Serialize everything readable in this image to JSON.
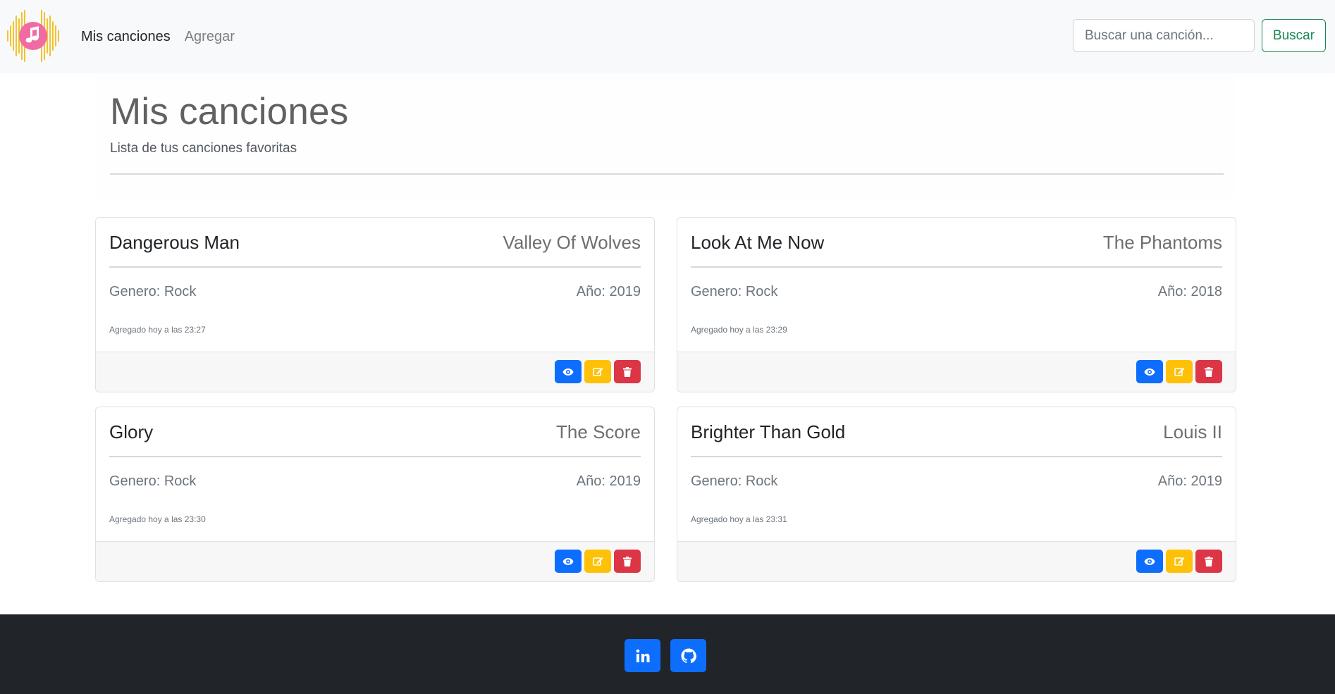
{
  "navbar": {
    "brand_icon": "music-note-logo",
    "links": [
      {
        "label": "Mis canciones",
        "active": true
      },
      {
        "label": "Agregar",
        "active": false
      }
    ],
    "search": {
      "placeholder": "Buscar una canción...",
      "value": "",
      "button_label": "Buscar"
    }
  },
  "header": {
    "title": "Mis canciones",
    "subtitle": "Lista de tus canciones favoritas"
  },
  "songs": [
    {
      "title": "Dangerous Man",
      "artist": "Valley Of Wolves",
      "genre": "Genero: Rock",
      "year": "Año: 2019",
      "added": "Agregado hoy a las 23:27"
    },
    {
      "title": "Look At Me Now",
      "artist": "The Phantoms",
      "genre": "Genero: Rock",
      "year": "Año: 2018",
      "added": "Agregado hoy a las 23:29"
    },
    {
      "title": "Glory",
      "artist": "The Score",
      "genre": "Genero: Rock",
      "year": "Año: 2019",
      "added": "Agregado hoy a las 23:30"
    },
    {
      "title": "Brighter Than Gold",
      "artist": "Louis II",
      "genre": "Genero: Rock",
      "year": "Año: 2019",
      "added": "Agregado hoy a las 23:31"
    }
  ],
  "card_actions": {
    "view_icon": "eye-icon",
    "edit_icon": "edit-icon",
    "delete_icon": "trash-icon"
  },
  "footer": {
    "links": [
      {
        "icon": "linkedin-icon"
      },
      {
        "icon": "github-icon"
      }
    ]
  },
  "colors": {
    "primary": "#0d6efd",
    "warning": "#ffc107",
    "danger": "#dc3545",
    "success": "#198754",
    "footer_bg": "#212529"
  }
}
